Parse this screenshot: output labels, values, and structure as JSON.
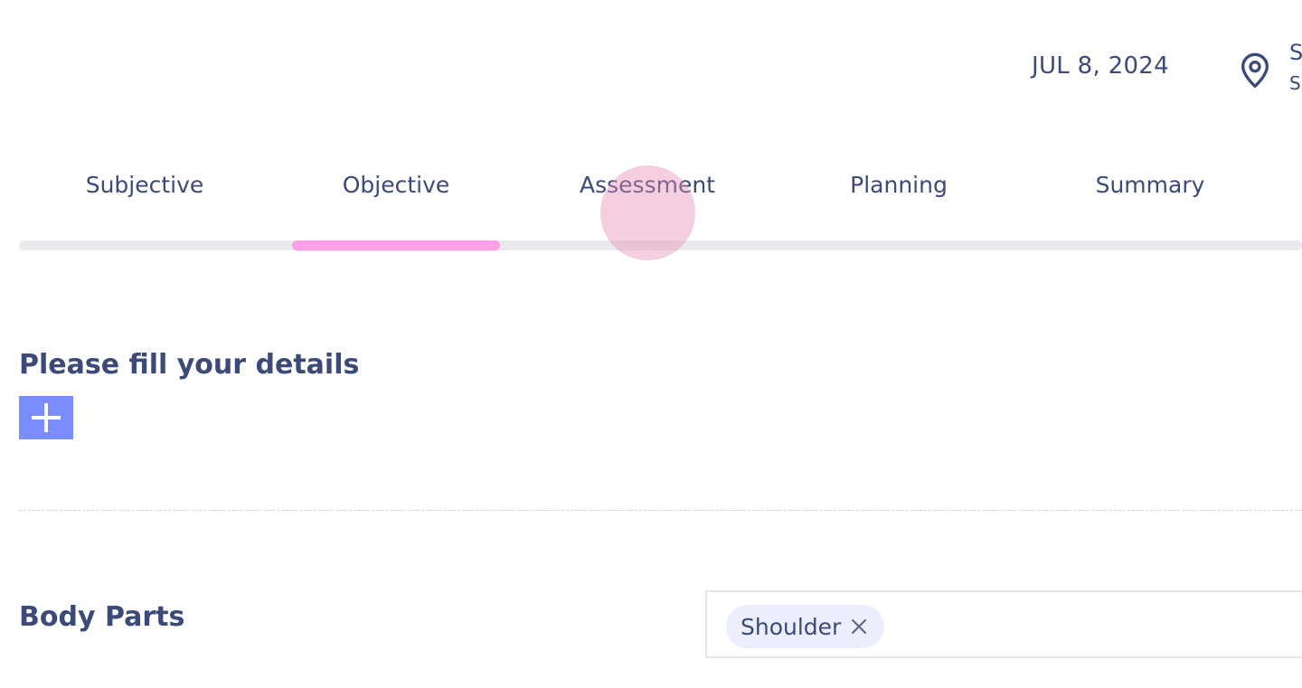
{
  "header": {
    "date": "JUL 8, 2024",
    "location_icon": "map-pin-icon",
    "location_title": "S",
    "location_subtitle": "S"
  },
  "tabs": [
    {
      "label": "Subjective",
      "active": false
    },
    {
      "label": "Objective",
      "active": true
    },
    {
      "label": "Assessment",
      "active": false
    },
    {
      "label": "Planning",
      "active": false
    },
    {
      "label": "Summary",
      "active": false
    }
  ],
  "colors": {
    "text": "#3b4a78",
    "active_indicator": "#ff9ee6",
    "track": "#e8eaee",
    "add_button": "#7b8cff",
    "chip_bg": "#eceefe"
  },
  "form": {
    "section_title": "Please fill your details",
    "add_button_icon": "plus-icon",
    "body_parts": {
      "label": "Body Parts",
      "selected": [
        {
          "label": "Shoulder",
          "remove_icon": "close-icon"
        }
      ]
    }
  }
}
